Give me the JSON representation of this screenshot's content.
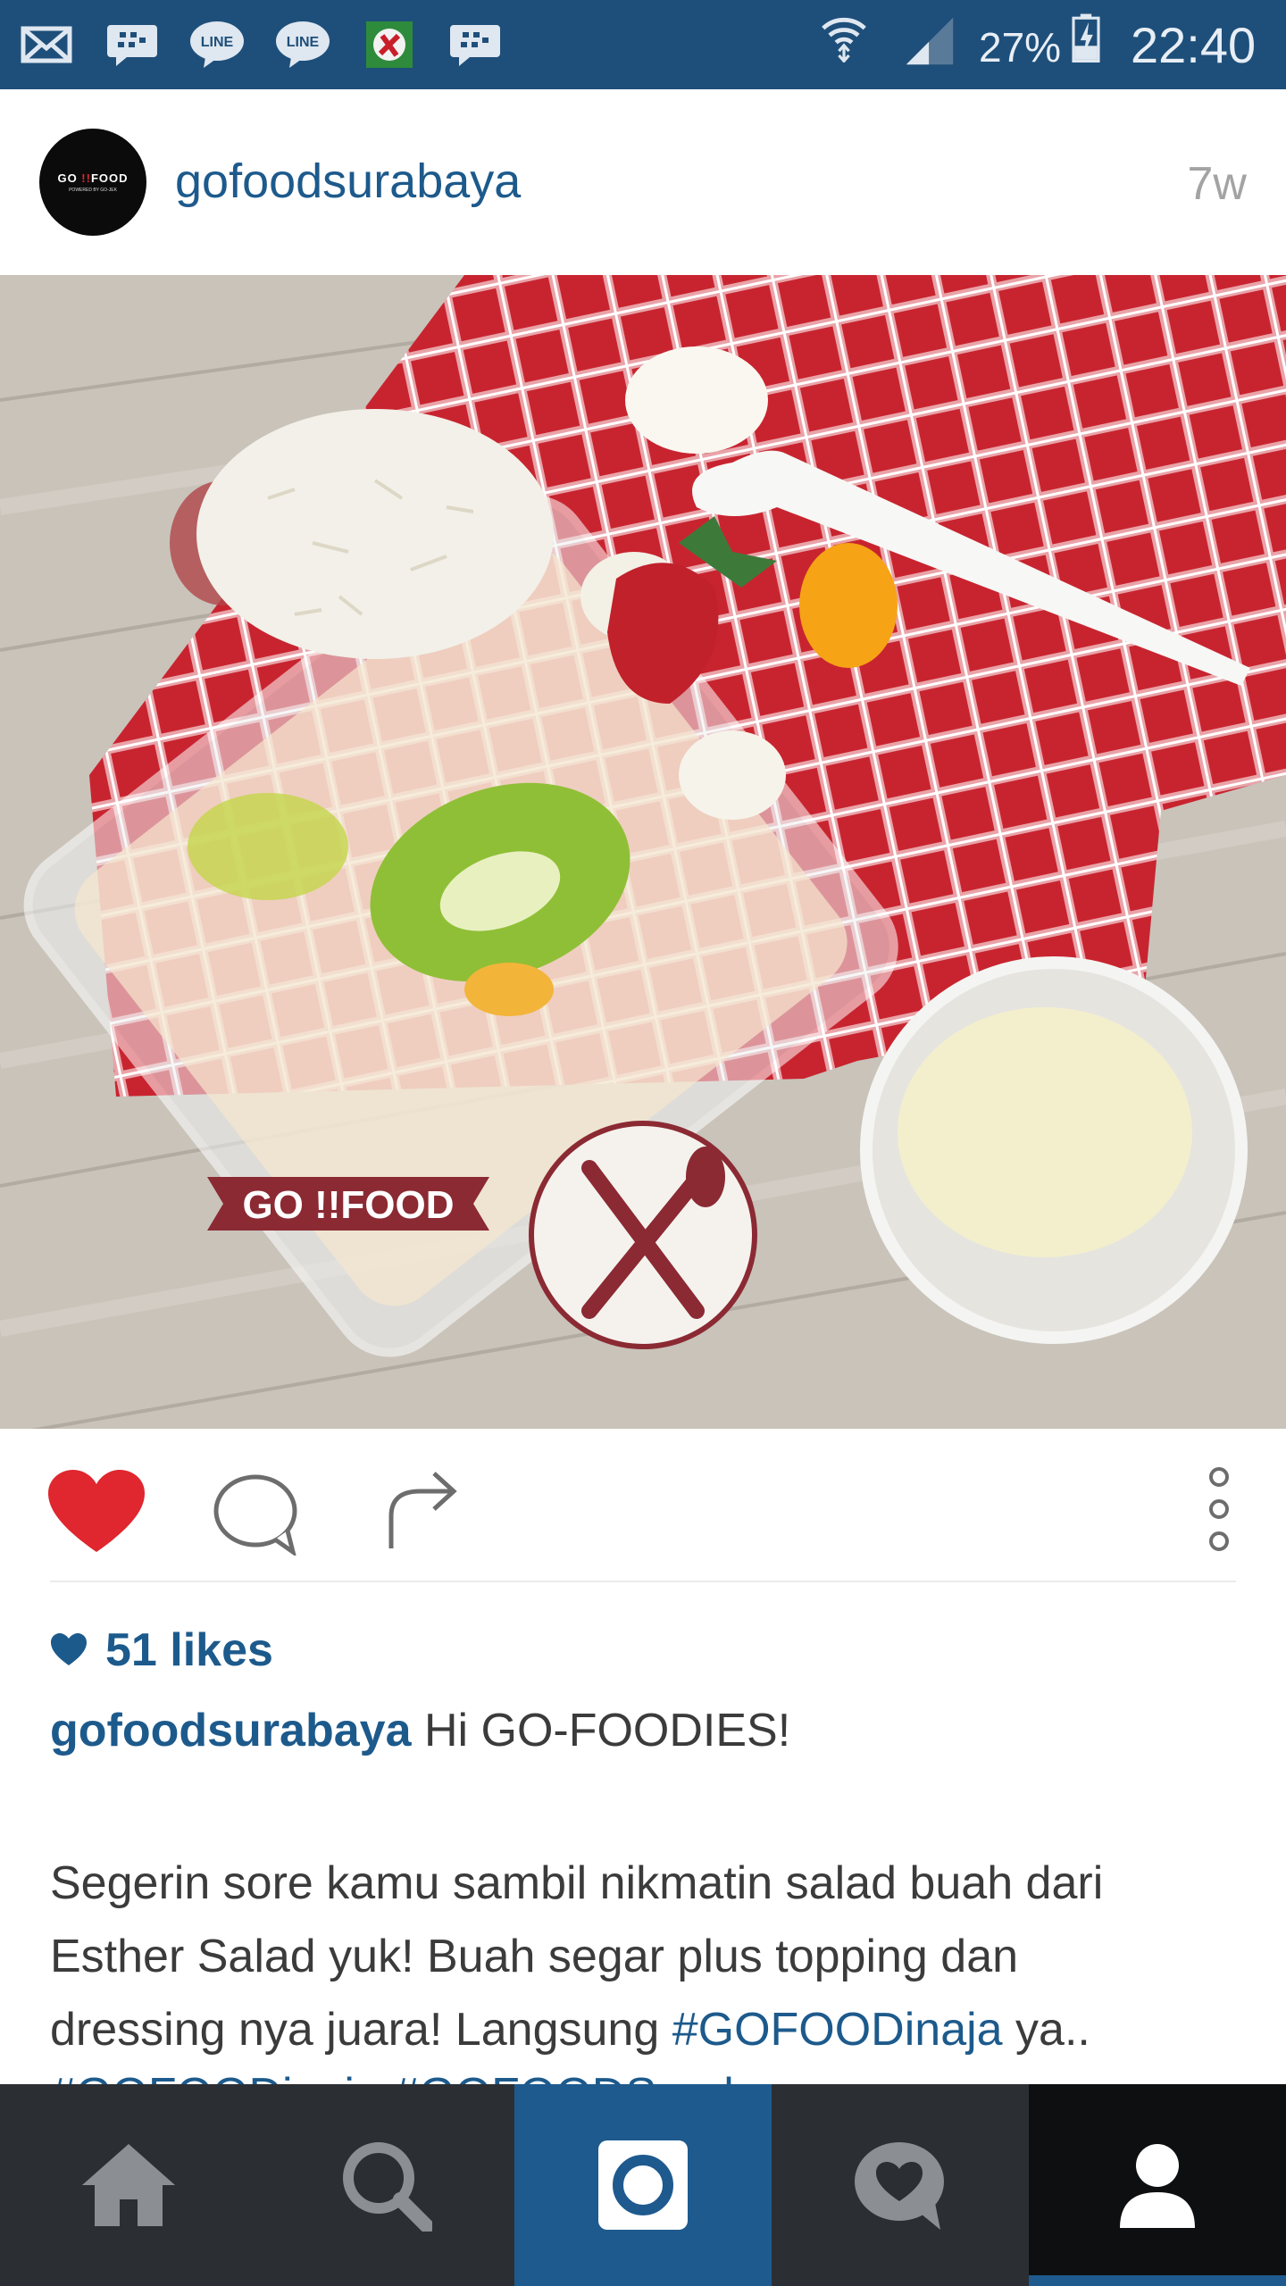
{
  "status_bar": {
    "battery": "27%",
    "time": "22:40",
    "notification_icons": [
      "mail-icon",
      "bbm-icon",
      "line-icon",
      "line-icon",
      "app-icon",
      "bbm-icon"
    ]
  },
  "post": {
    "username": "gofoodsurabaya",
    "time_ago": "7w",
    "image_text": {
      "brand": "GO",
      "brand2": "FOOD"
    }
  },
  "actions": {
    "liked": true,
    "like_color": "#e0262e"
  },
  "caption": {
    "likes": "51 likes",
    "username": "gofoodsurabaya",
    "greeting": "Hi GO-FOODIES!",
    "body_line1": "Segerin sore kamu sambil nikmatin salad buah dari",
    "body_line2": "Esther Salad yuk! Buah segar plus topping dan",
    "body_line3_prefix": "dressing nya juara! Langsung ",
    "body_line3_hashtag": "#GOFOODinaja",
    "body_line3_suffix": " ya..",
    "cutoff": "#GOFOODinaja #GOFOODSurabaya"
  },
  "nav": {
    "items": [
      "home-icon",
      "search-icon",
      "camera-icon",
      "activity-icon",
      "profile-icon"
    ],
    "active": "profile"
  },
  "colors": {
    "status_bar": "#1e4f7a",
    "link": "#1d5a8c",
    "nav_bg": "#2b2e33",
    "camera_bg": "#1e5a8e"
  }
}
